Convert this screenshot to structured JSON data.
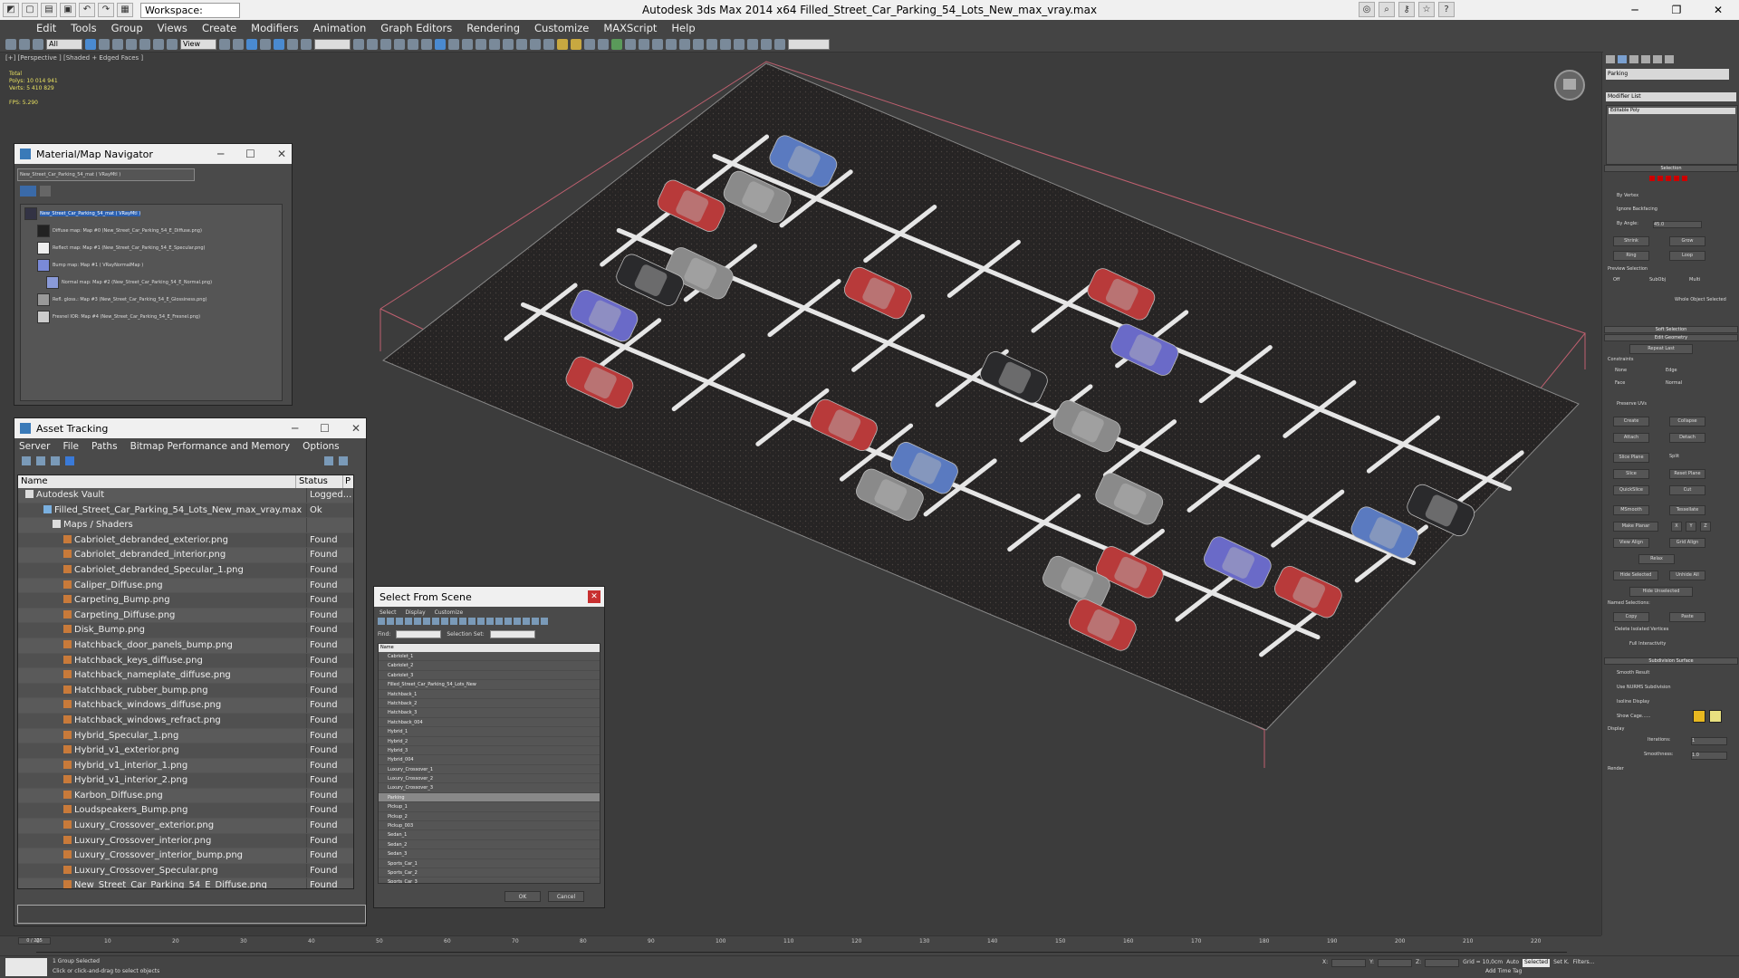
{
  "titlebar": {
    "workspace": "Workspace: Default",
    "app_title": "Autodesk 3ds Max  2014 x64      Filled_Street_Car_Parking_54_Lots_New_max_vray.max"
  },
  "menu": [
    "Edit",
    "Tools",
    "Group",
    "Views",
    "Create",
    "Modifiers",
    "Animation",
    "Graph Editors",
    "Rendering",
    "Customize",
    "MAXScript",
    "Help"
  ],
  "viewport": {
    "label": "[+] [Perspective ] [Shaded + Edged Faces ]",
    "stats": [
      "Total",
      "Polys:  10 014 941",
      "Verts:  5 410 829",
      "",
      "FPS:    5.290"
    ]
  },
  "matnav": {
    "title": "Material/Map Navigator",
    "path": "New_Street_Car_Parking_54_mat  ( VRayMtl )",
    "items": [
      "New_Street_Car_Parking_54_mat  ( VRayMtl )",
      "Diffuse map: Map #0 (New_Street_Car_Parking_54_E_Diffuse.png)",
      "Reflect map: Map #1 (New_Street_Car_Parking_54_E_Specular.png)",
      "Bump map: Map #1  ( VRayNormalMap )",
      "Normal map: Map #2 (New_Street_Car_Parking_54_E_Normal.png)",
      "Refl. gloss.: Map #3 (New_Street_Car_Parking_54_E_Glossiness.png)",
      "Fresnel IOR: Map #4 (New_Street_Car_Parking_54_E_Fresnel.png)"
    ]
  },
  "asset": {
    "title": "Asset Tracking",
    "menu": [
      "Server",
      "File",
      "Paths",
      "Bitmap Performance and Memory",
      "Options"
    ],
    "col_name": "Name",
    "col_status": "Status",
    "col_p": "P",
    "rows": [
      {
        "name": "Autodesk Vault",
        "status": "Logged..."
      },
      {
        "name": "Filled_Street_Car_Parking_54_Lots_New_max_vray.max",
        "status": "Ok"
      },
      {
        "name": "Maps / Shaders",
        "status": ""
      },
      {
        "name": "Cabriolet_debranded_exterior.png",
        "status": "Found"
      },
      {
        "name": "Cabriolet_debranded_interior.png",
        "status": "Found"
      },
      {
        "name": "Cabriolet_debranded_Specular_1.png",
        "status": "Found"
      },
      {
        "name": "Caliper_Diffuse.png",
        "status": "Found"
      },
      {
        "name": "Carpeting_Bump.png",
        "status": "Found"
      },
      {
        "name": "Carpeting_Diffuse.png",
        "status": "Found"
      },
      {
        "name": "Disk_Bump.png",
        "status": "Found"
      },
      {
        "name": "Hatchback_door_panels_bump.png",
        "status": "Found"
      },
      {
        "name": "Hatchback_keys_diffuse.png",
        "status": "Found"
      },
      {
        "name": "Hatchback_nameplate_diffuse.png",
        "status": "Found"
      },
      {
        "name": "Hatchback_rubber_bump.png",
        "status": "Found"
      },
      {
        "name": "Hatchback_windows_diffuse.png",
        "status": "Found"
      },
      {
        "name": "Hatchback_windows_refract.png",
        "status": "Found"
      },
      {
        "name": "Hybrid_Specular_1.png",
        "status": "Found"
      },
      {
        "name": "Hybrid_v1_exterior.png",
        "status": "Found"
      },
      {
        "name": "Hybrid_v1_interior_1.png",
        "status": "Found"
      },
      {
        "name": "Hybrid_v1_interior_2.png",
        "status": "Found"
      },
      {
        "name": "Karbon_Diffuse.png",
        "status": "Found"
      },
      {
        "name": "Loudspeakers_Bump.png",
        "status": "Found"
      },
      {
        "name": "Luxury_Crossover_exterior.png",
        "status": "Found"
      },
      {
        "name": "Luxury_Crossover_interior.png",
        "status": "Found"
      },
      {
        "name": "Luxury_Crossover_interior_bump.png",
        "status": "Found"
      },
      {
        "name": "Luxury_Crossover_Specular.png",
        "status": "Found"
      },
      {
        "name": "New_Street_Car_Parking_54_E_Diffuse.png",
        "status": "Found"
      }
    ]
  },
  "selscene": {
    "title": "Select From Scene",
    "menu": [
      "Select",
      "Display",
      "Customize"
    ],
    "find_label": "Find:",
    "selection_set": "Selection Set:",
    "col_name": "Name",
    "items": [
      "Cabriolet_1",
      "Cabriolet_2",
      "Cabriolet_3",
      "Filled_Street_Car_Parking_54_Lots_New",
      "Hatchback_1",
      "Hatchback_2",
      "Hatchback_3",
      "Hatchback_004",
      "Hybrid_1",
      "Hybrid_2",
      "Hybrid_3",
      "Hybrid_004",
      "Luxury_Crossover_1",
      "Luxury_Crossover_2",
      "Luxury_Crossover_3",
      "Parking",
      "Pickup_1",
      "Pickup_2",
      "Pickup_003",
      "Sedan_1",
      "Sedan_2",
      "Sedan_3",
      "Sports_Car_1",
      "Sports_Car_2",
      "Sports_Car_3"
    ],
    "selected": "Parking",
    "ok": "OK",
    "cancel": "Cancel"
  },
  "cmdpanel": {
    "object_name": "Parking",
    "modifier_list": "Modifier List",
    "stack_item": "Editable Poly",
    "selection": "Selection",
    "by_vertex": "By Vertex",
    "ignore_backfacing": "Ignore Backfacing",
    "by_angle": "By Angle:",
    "angle": "45.0",
    "shrink": "Shrink",
    "grow": "Grow",
    "ring": "Ring",
    "loop": "Loop",
    "preview_selection": "Preview Selection",
    "off": "Off",
    "subobj": "SubObj",
    "multi": "Multi",
    "whole_object": "Whole Object Selected",
    "soft_selection": "Soft Selection",
    "edit_geometry": "Edit Geometry",
    "repeat_last": "Repeat Last",
    "constraints": "Constraints",
    "none": "None",
    "edge": "Edge",
    "face": "Face",
    "normal": "Normal",
    "preserve_uvs": "Preserve UVs",
    "create": "Create",
    "collapse": "Collapse",
    "attach": "Attach",
    "detach": "Detach",
    "slice_plane": "Slice Plane",
    "split": "Split",
    "slice": "Slice",
    "reset_plane": "Reset Plane",
    "quickslice": "QuickSlice",
    "cut": "Cut",
    "msmooth": "MSmooth",
    "tessellate": "Tessellate",
    "make_planar": "Make Planar",
    "x": "X",
    "y": "Y",
    "z": "Z",
    "view_align": "View Align",
    "grid_align": "Grid Align",
    "relax": "Relax",
    "hide_selected": "Hide Selected",
    "unhide_all": "Unhide All",
    "hide_unselected": "Hide Unselected",
    "named_selections": "Named Selections:",
    "copy": "Copy",
    "paste": "Paste",
    "delete_isolated": "Delete Isolated Vertices",
    "full_interactivity": "Full Interactivity",
    "subdivision_surface": "Subdivision Surface",
    "smooth_result": "Smooth Result",
    "use_nurms": "Use NURMS Subdivision",
    "isoline": "Isoline Display",
    "show_cage": "Show Cage......",
    "display": "Display",
    "iterations": "Iterations:",
    "iterations_val": "1",
    "smoothness": "Smoothness:",
    "smoothness_val": "1.0",
    "render": "Render",
    "cage_color1": "#e8b820",
    "cage_color2": "#e8e080"
  },
  "timeline": {
    "slider": "0 / 225",
    "ticks": [
      "0",
      "10",
      "20",
      "30",
      "40",
      "50",
      "60",
      "70",
      "80",
      "90",
      "100",
      "110",
      "120",
      "130",
      "140",
      "150",
      "160",
      "170",
      "180",
      "190",
      "200",
      "210",
      "220"
    ]
  },
  "status": {
    "line1": "1 Group Selected",
    "line2": "Click or click-and-drag to select objects",
    "grid": "Grid = 10,0cm",
    "auto": "Auto",
    "selected": "Selected",
    "set_k": "Set K.",
    "filters": "Filters...",
    "add_time_tag": "Add Time Tag",
    "x_label": "X:",
    "y_label": "Y:",
    "z_label": "Z:"
  },
  "scene": {
    "cars": [
      {
        "type": "pickup-blue"
      },
      {
        "type": "grey"
      },
      {
        "type": "red"
      },
      {
        "type": "red"
      },
      {
        "type": "grey"
      },
      {
        "type": "dark"
      },
      {
        "type": "blue"
      },
      {
        "type": "red"
      },
      {
        "type": "red"
      },
      {
        "type": "blue"
      },
      {
        "type": "dark"
      },
      {
        "type": "grey"
      },
      {
        "type": "red"
      },
      {
        "type": "pickup-blue"
      },
      {
        "type": "grey"
      },
      {
        "type": "grey"
      },
      {
        "type": "pickup-blue"
      },
      {
        "type": "dark"
      },
      {
        "type": "red"
      },
      {
        "type": "red"
      },
      {
        "type": "blue"
      },
      {
        "type": "grey"
      },
      {
        "type": "red"
      }
    ]
  }
}
